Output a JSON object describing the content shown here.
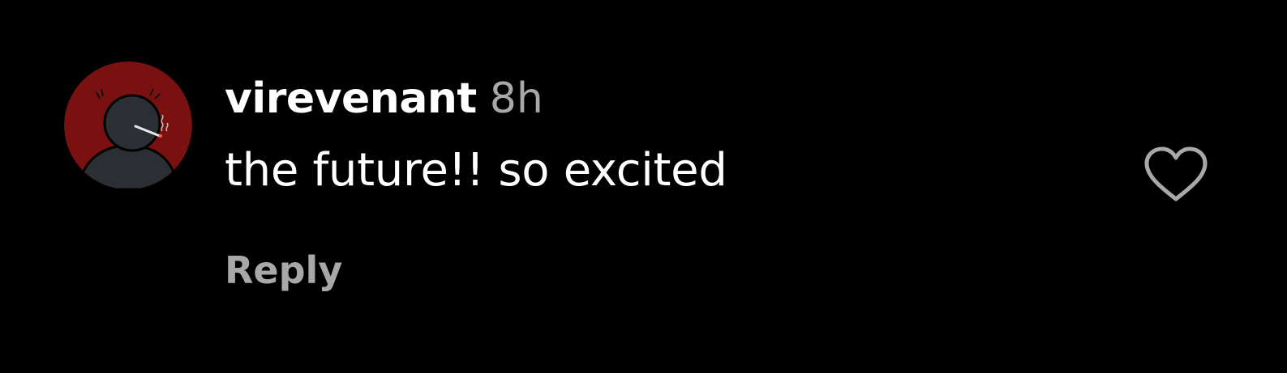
{
  "comment": {
    "username": "virevenant",
    "timestamp": "8h",
    "text": "the future!! so excited",
    "reply_label": "Reply",
    "liked": false,
    "avatar_icon": "avatar-icon",
    "like_icon": "heart-outline-icon"
  },
  "colors": {
    "background": "#000000",
    "primary_text": "#ffffff",
    "secondary_text": "#a8a8a8",
    "avatar_background": "#7a1111",
    "avatar_figure": "#2b2e33"
  }
}
